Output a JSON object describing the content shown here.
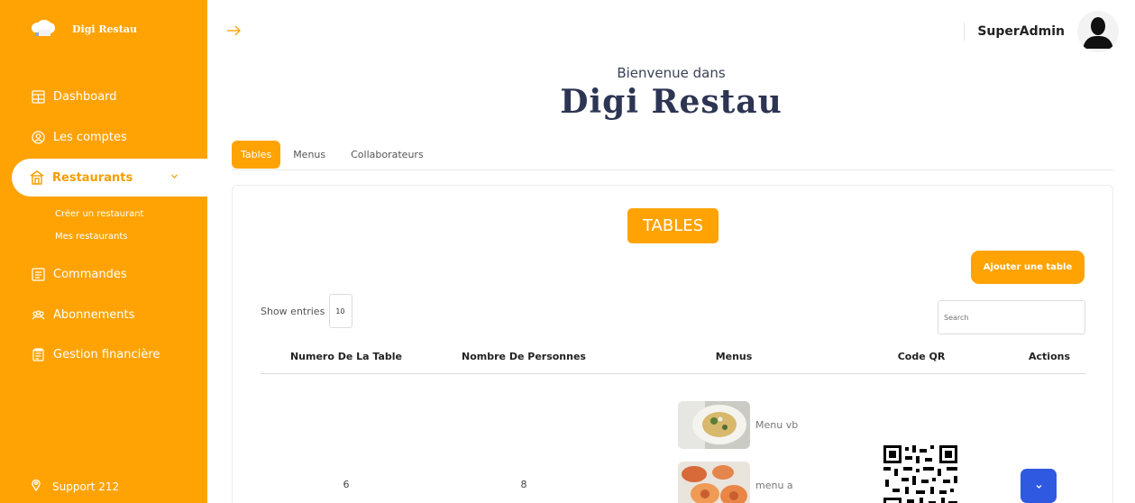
{
  "sidebar": {
    "brand": "Digi Restau",
    "items": [
      {
        "label": "Dashboard",
        "icon": "dashboard-icon"
      },
      {
        "label": "Les comptes",
        "icon": "accounts-icon"
      },
      {
        "label": "Restaurants",
        "icon": "restaurant-icon"
      },
      {
        "label": "Commandes",
        "icon": "orders-icon"
      },
      {
        "label": "Abonnements",
        "icon": "subscriptions-icon"
      },
      {
        "label": "Gestion financière",
        "icon": "finance-icon"
      }
    ],
    "sub_items": [
      "Créer un restaurant",
      "Mes restaurants"
    ],
    "support": "Support 212"
  },
  "header": {
    "user_name": "SuperAdmin",
    "welcome": "Bienvenue dans",
    "title": "Digi Restau"
  },
  "tabs": [
    "Tables",
    "Menus",
    "Collaborateurs"
  ],
  "card": {
    "title": "TABLES",
    "add_button": "Ajouter une table",
    "show_entries_label": "Show entries",
    "entries_value": "10",
    "search_placeholder": "Search"
  },
  "table": {
    "columns": [
      "Numero De La Table",
      "Nombre De Personnes",
      "Menus",
      "Code QR",
      "Actions"
    ],
    "rows": [
      {
        "numero": "6",
        "personnes": "8",
        "menus": [
          "Menu vb",
          "menu a"
        ]
      }
    ]
  },
  "colors": {
    "accent": "#ffa304",
    "title": "#2d3553",
    "action": "#2f59e0"
  }
}
